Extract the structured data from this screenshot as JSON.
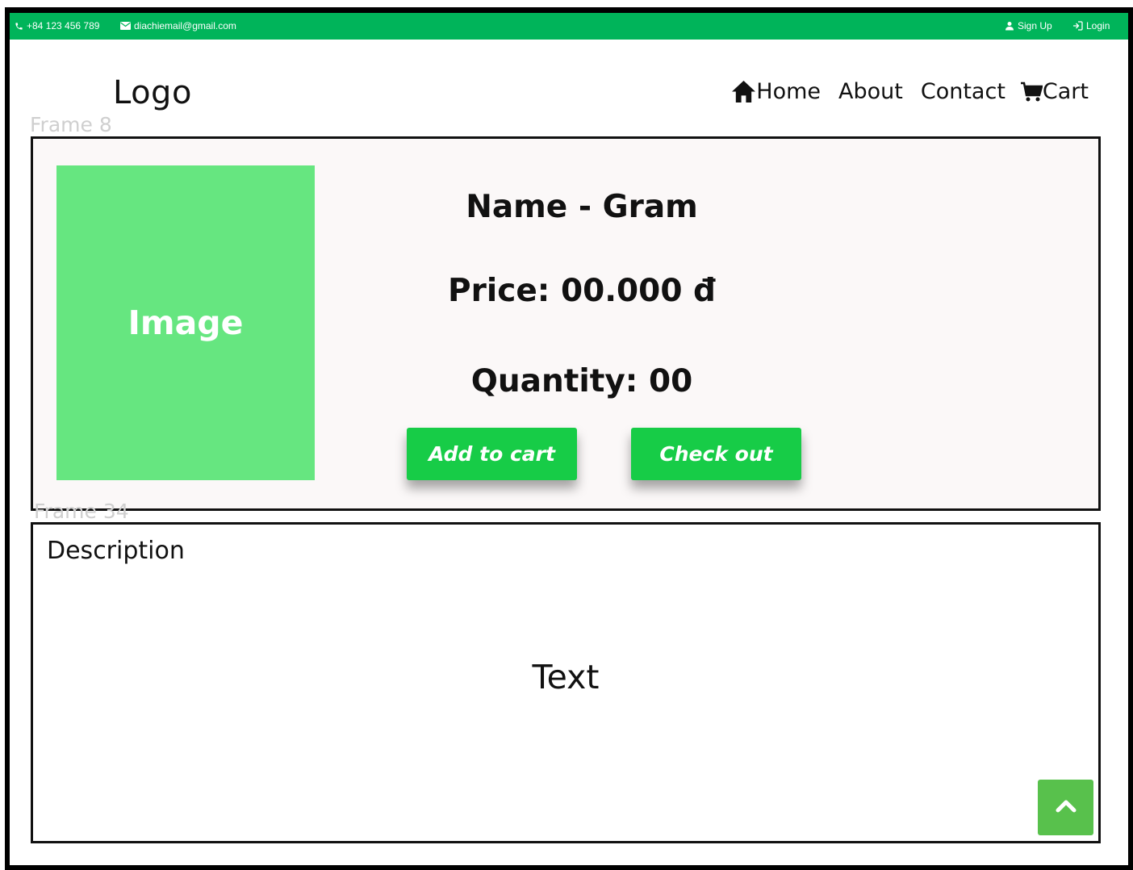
{
  "topbar": {
    "phone": "+84 123 456 789",
    "email": "diachiemail@gmail.com",
    "signup_label": "Sign Up",
    "login_label": "Login"
  },
  "header": {
    "logo": "Logo",
    "nav": {
      "home": "Home",
      "about": "About",
      "contact": "Contact",
      "cart": "Cart"
    }
  },
  "frame_labels": {
    "frame_8": "Frame 8",
    "frame_34": "Frame 34"
  },
  "product": {
    "image_placeholder": "Image",
    "name": "Name - Gram",
    "price": "Price: 00.000 đ",
    "quantity": "Quantity: 00",
    "add_to_cart_label": "Add to cart",
    "checkout_label": "Check out"
  },
  "description": {
    "title": "Description",
    "text": "Text"
  },
  "colors": {
    "topbar": "#00b45a",
    "image_placeholder": "#66e680",
    "buttons": "#17cc47",
    "scroll_top": "#58c14c"
  },
  "icons": [
    "phone-icon",
    "mail-icon",
    "user-icon",
    "login-icon",
    "home-icon",
    "cart-icon",
    "chevron-up-icon"
  ]
}
